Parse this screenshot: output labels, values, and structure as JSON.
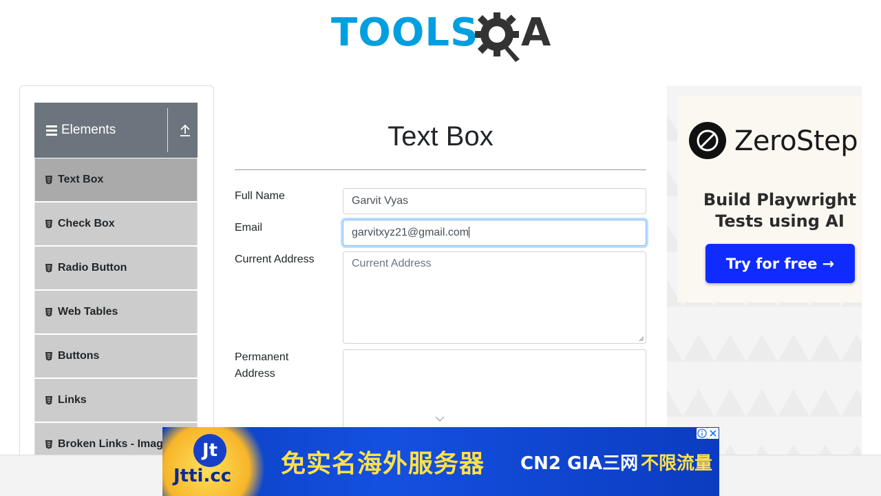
{
  "logo": {
    "part1": "TOOLS",
    "part2": "A"
  },
  "sidebar": {
    "group_title": "Elements",
    "items": [
      {
        "label": "Text Box"
      },
      {
        "label": "Check Box"
      },
      {
        "label": "Radio Button"
      },
      {
        "label": "Web Tables"
      },
      {
        "label": "Buttons"
      },
      {
        "label": "Links"
      },
      {
        "label": "Broken Links - Images"
      }
    ]
  },
  "main": {
    "title": "Text Box",
    "fields": {
      "full_name_label": "Full Name",
      "full_name_value": "Garvit Vyas",
      "email_label": "Email",
      "email_value": "garvitxyz21@gmail.com",
      "current_address_label": "Current Address",
      "current_address_placeholder": "Current Address",
      "permanent_address_label": "Permanent Address"
    }
  },
  "right_ad": {
    "brand": "ZeroStep",
    "tagline": "Build Playwright Tests using AI",
    "cta": "Try for free →"
  },
  "bottom_ad": {
    "logo_text": "Jt",
    "site": "Jtti.cc",
    "headline": "免实名海外服务器",
    "middle": "CN2 GIA三网",
    "right": "不限流量"
  },
  "colors": {
    "brand_blue": "#009fdf",
    "sidebar_header": "#6c757d",
    "active_item": "#aaaaaa",
    "menu_item": "#cccccc",
    "cta_blue": "#0f2bff"
  }
}
